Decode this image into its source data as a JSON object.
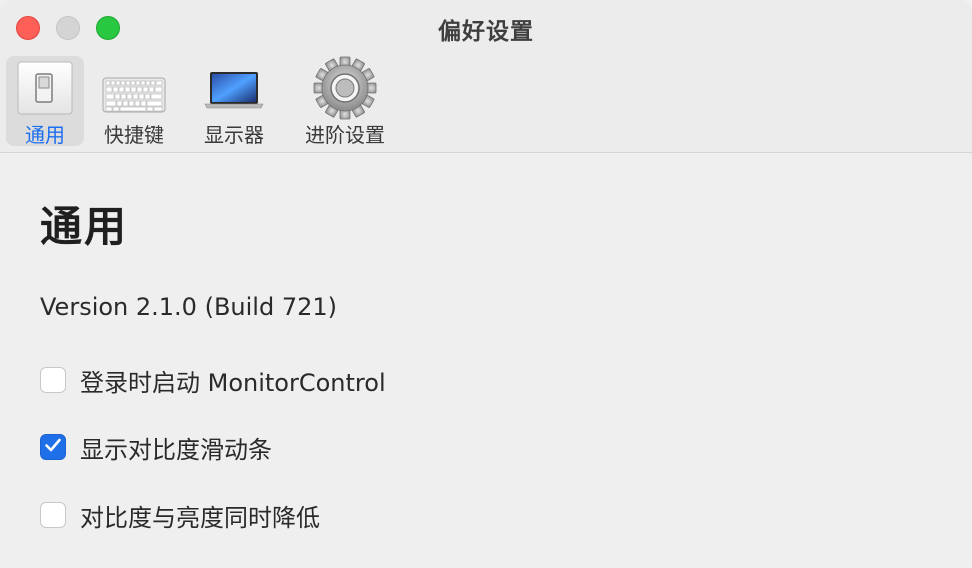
{
  "window": {
    "title": "偏好设置"
  },
  "toolbar": {
    "items": [
      {
        "label": "通用",
        "icon": "toggle-switch-icon",
        "selected": true
      },
      {
        "label": "快捷键",
        "icon": "keyboard-icon",
        "selected": false
      },
      {
        "label": "显示器",
        "icon": "laptop-icon",
        "selected": false
      },
      {
        "label": "进阶设置",
        "icon": "gear-icon",
        "selected": false
      }
    ]
  },
  "general": {
    "title": "通用",
    "version": "Version 2.1.0 (Build 721)",
    "options": [
      {
        "label": "登录时启动 MonitorControl",
        "checked": false
      },
      {
        "label": "显示对比度滑动条",
        "checked": true
      },
      {
        "label": "对比度与亮度同时降低",
        "checked": false
      }
    ]
  },
  "colors": {
    "accent": "#1f6fe8",
    "close": "#ff5f57",
    "zoom": "#28c840"
  }
}
